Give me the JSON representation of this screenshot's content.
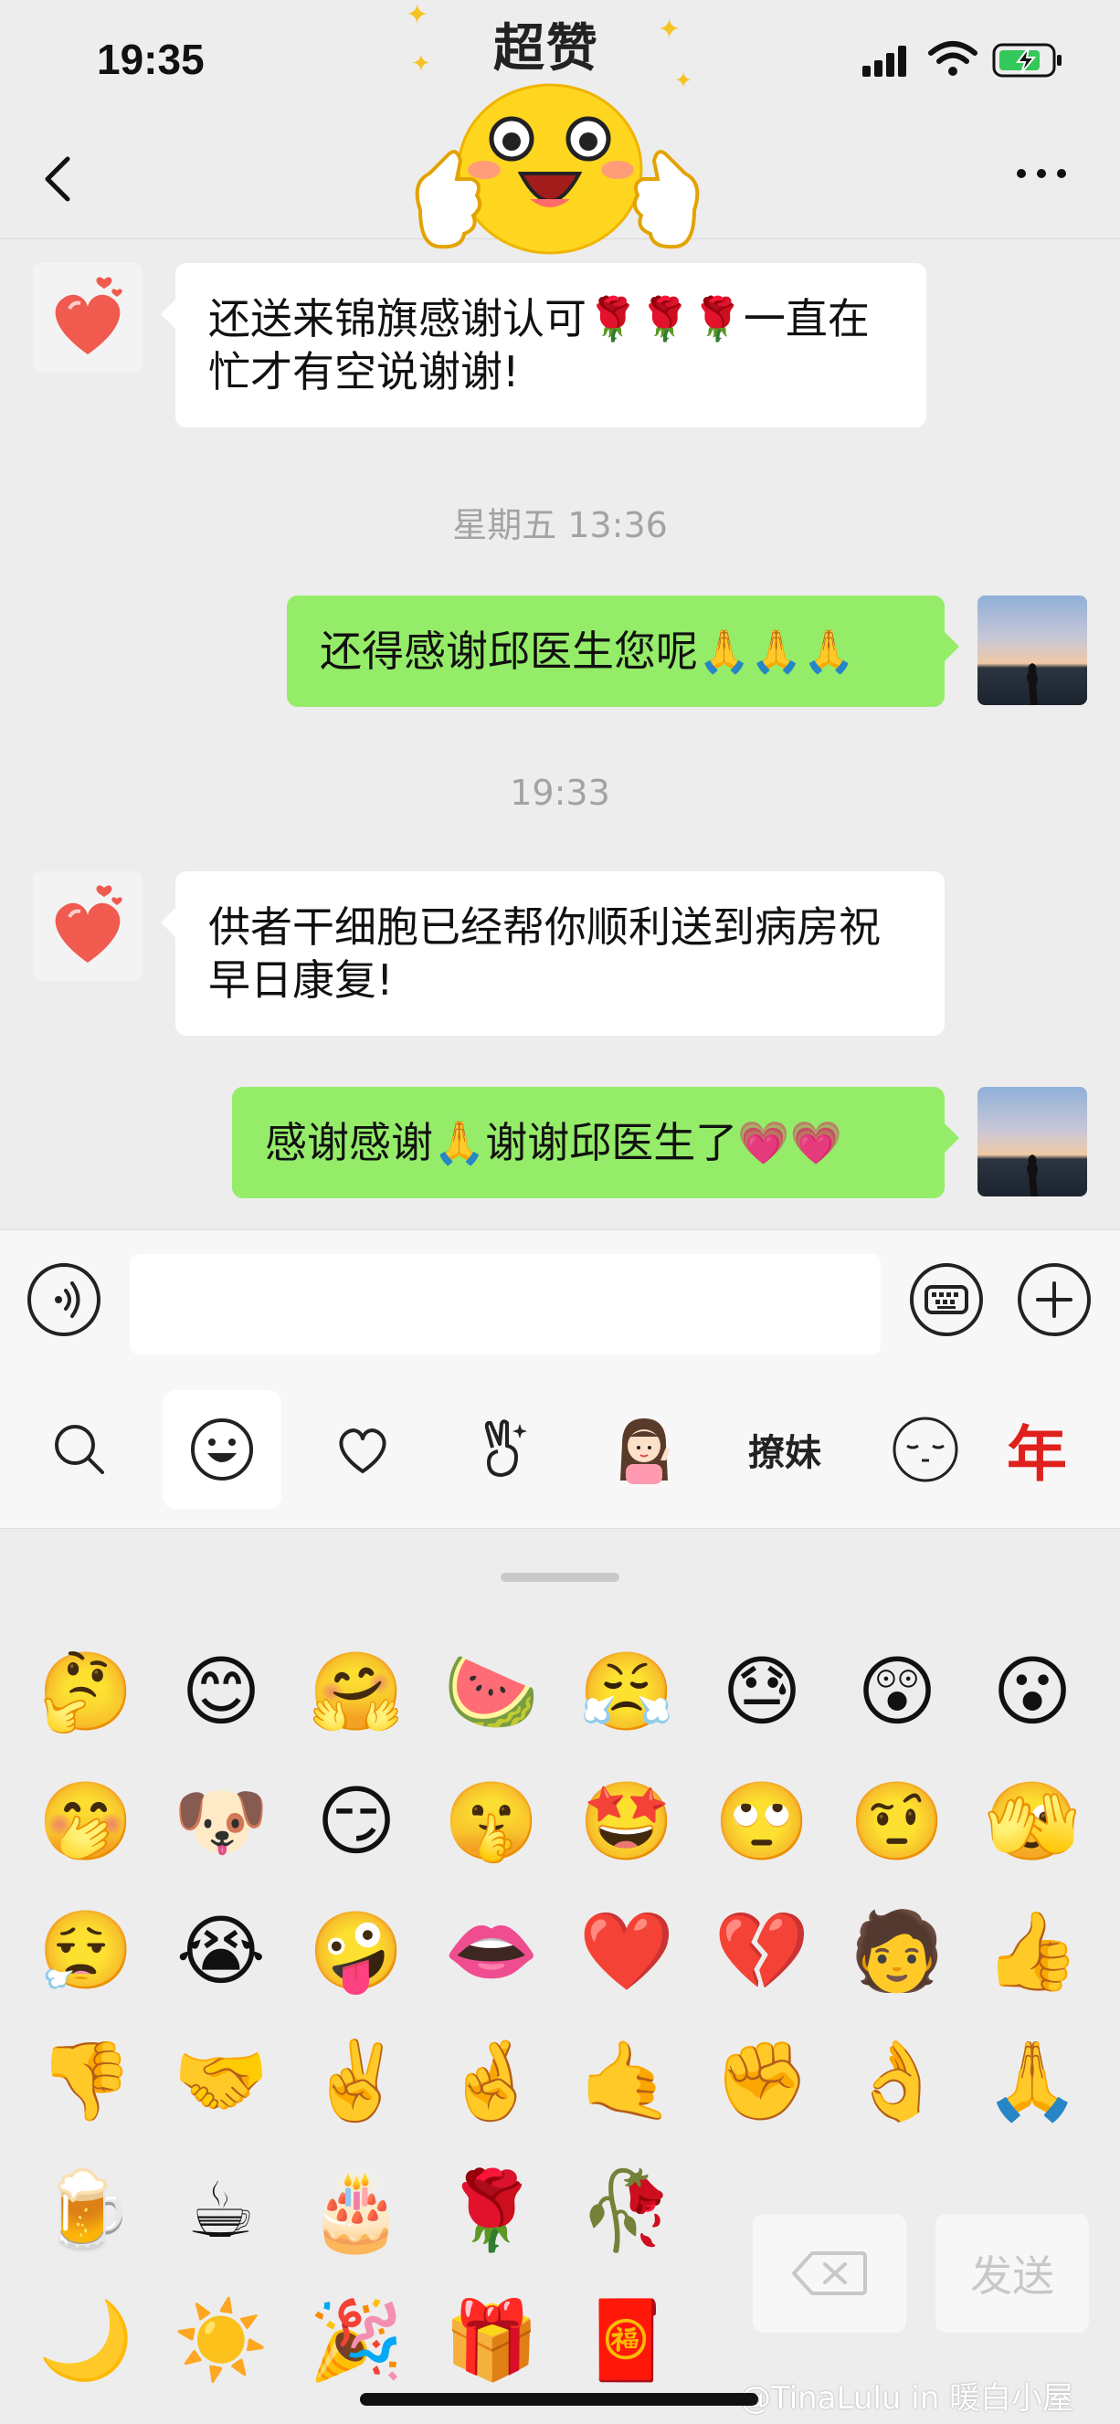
{
  "status_bar": {
    "time": "19:35"
  },
  "sticker": {
    "title": "超赞"
  },
  "chat": {
    "messages": [
      {
        "side": "left",
        "text": "还送来锦旗感谢认可🌹🌹🌹一直在忙才有空说谢谢!"
      },
      {
        "side": "right",
        "text": "还得感谢邱医生您呢🙏🙏🙏"
      },
      {
        "side": "left",
        "text": "供者干细胞已经帮你顺利送到病房祝早日康复!"
      },
      {
        "side": "right",
        "text": "感谢感谢🙏谢谢邱医生了💗💗"
      }
    ],
    "timestamps": [
      "星期五 13:36",
      "19:33"
    ]
  },
  "input": {
    "value": "",
    "placeholder": ""
  },
  "tabs": {
    "labels": [
      "search",
      "emoji",
      "favorites",
      "gestures",
      "sticker-girl",
      "撩妹",
      "face",
      "年"
    ],
    "text_tab": "撩妹",
    "nian_tab": "年"
  },
  "emoji_grid": [
    [
      "🤔",
      "😊",
      "🤗",
      "🍉",
      "😤",
      "😓",
      "😲",
      "😮"
    ],
    [
      "🤭",
      "🐶",
      "😏",
      "🤫",
      "🤩",
      "🙄",
      "🤨",
      "🫣"
    ],
    [
      "😮‍💨",
      "😭",
      "🤪",
      "👄",
      "❤️",
      "💔",
      "🧑",
      "👍"
    ],
    [
      "👎",
      "🤝",
      "✌️",
      "🤞",
      "🤙",
      "✊",
      "👌",
      "🙏"
    ],
    [
      "🍺",
      "☕",
      "🎂",
      "🌹",
      "🥀"
    ],
    [
      "🌙",
      "☀️",
      "🎉",
      "🎁",
      "🧧"
    ]
  ],
  "actions": {
    "send": "发送"
  },
  "watermark": "@TinaLulu in 暖白小屋",
  "colors": {
    "bubble_right": "#95ec69",
    "bubble_left": "#ffffff",
    "background": "#ededed"
  }
}
